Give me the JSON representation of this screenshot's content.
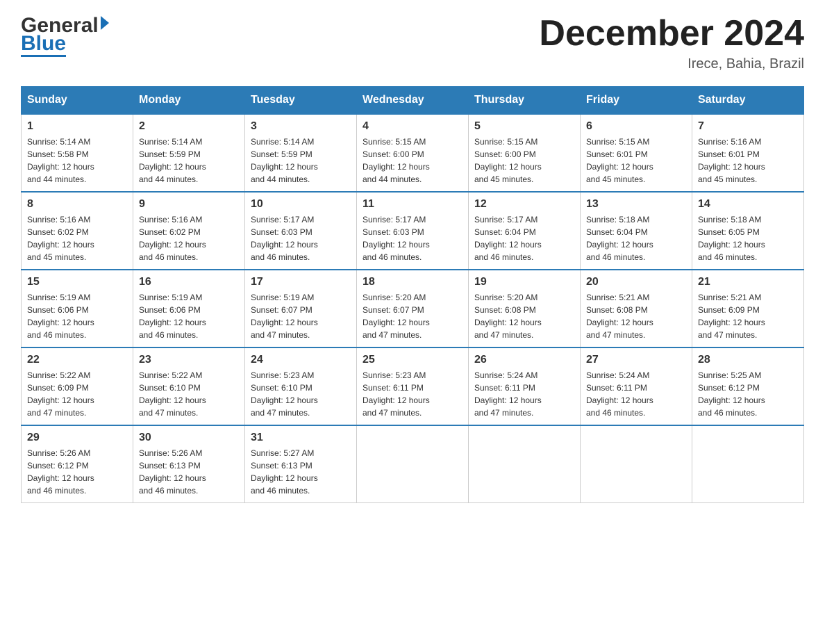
{
  "header": {
    "logo_general": "General",
    "logo_blue": "Blue",
    "title": "December 2024",
    "subtitle": "Irece, Bahia, Brazil"
  },
  "weekdays": [
    "Sunday",
    "Monday",
    "Tuesday",
    "Wednesday",
    "Thursday",
    "Friday",
    "Saturday"
  ],
  "weeks": [
    [
      {
        "day": "1",
        "sunrise": "5:14 AM",
        "sunset": "5:58 PM",
        "daylight": "12 hours and 44 minutes."
      },
      {
        "day": "2",
        "sunrise": "5:14 AM",
        "sunset": "5:59 PM",
        "daylight": "12 hours and 44 minutes."
      },
      {
        "day": "3",
        "sunrise": "5:14 AM",
        "sunset": "5:59 PM",
        "daylight": "12 hours and 44 minutes."
      },
      {
        "day": "4",
        "sunrise": "5:15 AM",
        "sunset": "6:00 PM",
        "daylight": "12 hours and 44 minutes."
      },
      {
        "day": "5",
        "sunrise": "5:15 AM",
        "sunset": "6:00 PM",
        "daylight": "12 hours and 45 minutes."
      },
      {
        "day": "6",
        "sunrise": "5:15 AM",
        "sunset": "6:01 PM",
        "daylight": "12 hours and 45 minutes."
      },
      {
        "day": "7",
        "sunrise": "5:16 AM",
        "sunset": "6:01 PM",
        "daylight": "12 hours and 45 minutes."
      }
    ],
    [
      {
        "day": "8",
        "sunrise": "5:16 AM",
        "sunset": "6:02 PM",
        "daylight": "12 hours and 45 minutes."
      },
      {
        "day": "9",
        "sunrise": "5:16 AM",
        "sunset": "6:02 PM",
        "daylight": "12 hours and 46 minutes."
      },
      {
        "day": "10",
        "sunrise": "5:17 AM",
        "sunset": "6:03 PM",
        "daylight": "12 hours and 46 minutes."
      },
      {
        "day": "11",
        "sunrise": "5:17 AM",
        "sunset": "6:03 PM",
        "daylight": "12 hours and 46 minutes."
      },
      {
        "day": "12",
        "sunrise": "5:17 AM",
        "sunset": "6:04 PM",
        "daylight": "12 hours and 46 minutes."
      },
      {
        "day": "13",
        "sunrise": "5:18 AM",
        "sunset": "6:04 PM",
        "daylight": "12 hours and 46 minutes."
      },
      {
        "day": "14",
        "sunrise": "5:18 AM",
        "sunset": "6:05 PM",
        "daylight": "12 hours and 46 minutes."
      }
    ],
    [
      {
        "day": "15",
        "sunrise": "5:19 AM",
        "sunset": "6:06 PM",
        "daylight": "12 hours and 46 minutes."
      },
      {
        "day": "16",
        "sunrise": "5:19 AM",
        "sunset": "6:06 PM",
        "daylight": "12 hours and 46 minutes."
      },
      {
        "day": "17",
        "sunrise": "5:19 AM",
        "sunset": "6:07 PM",
        "daylight": "12 hours and 47 minutes."
      },
      {
        "day": "18",
        "sunrise": "5:20 AM",
        "sunset": "6:07 PM",
        "daylight": "12 hours and 47 minutes."
      },
      {
        "day": "19",
        "sunrise": "5:20 AM",
        "sunset": "6:08 PM",
        "daylight": "12 hours and 47 minutes."
      },
      {
        "day": "20",
        "sunrise": "5:21 AM",
        "sunset": "6:08 PM",
        "daylight": "12 hours and 47 minutes."
      },
      {
        "day": "21",
        "sunrise": "5:21 AM",
        "sunset": "6:09 PM",
        "daylight": "12 hours and 47 minutes."
      }
    ],
    [
      {
        "day": "22",
        "sunrise": "5:22 AM",
        "sunset": "6:09 PM",
        "daylight": "12 hours and 47 minutes."
      },
      {
        "day": "23",
        "sunrise": "5:22 AM",
        "sunset": "6:10 PM",
        "daylight": "12 hours and 47 minutes."
      },
      {
        "day": "24",
        "sunrise": "5:23 AM",
        "sunset": "6:10 PM",
        "daylight": "12 hours and 47 minutes."
      },
      {
        "day": "25",
        "sunrise": "5:23 AM",
        "sunset": "6:11 PM",
        "daylight": "12 hours and 47 minutes."
      },
      {
        "day": "26",
        "sunrise": "5:24 AM",
        "sunset": "6:11 PM",
        "daylight": "12 hours and 47 minutes."
      },
      {
        "day": "27",
        "sunrise": "5:24 AM",
        "sunset": "6:11 PM",
        "daylight": "12 hours and 46 minutes."
      },
      {
        "day": "28",
        "sunrise": "5:25 AM",
        "sunset": "6:12 PM",
        "daylight": "12 hours and 46 minutes."
      }
    ],
    [
      {
        "day": "29",
        "sunrise": "5:26 AM",
        "sunset": "6:12 PM",
        "daylight": "12 hours and 46 minutes."
      },
      {
        "day": "30",
        "sunrise": "5:26 AM",
        "sunset": "6:13 PM",
        "daylight": "12 hours and 46 minutes."
      },
      {
        "day": "31",
        "sunrise": "5:27 AM",
        "sunset": "6:13 PM",
        "daylight": "12 hours and 46 minutes."
      },
      null,
      null,
      null,
      null
    ]
  ]
}
